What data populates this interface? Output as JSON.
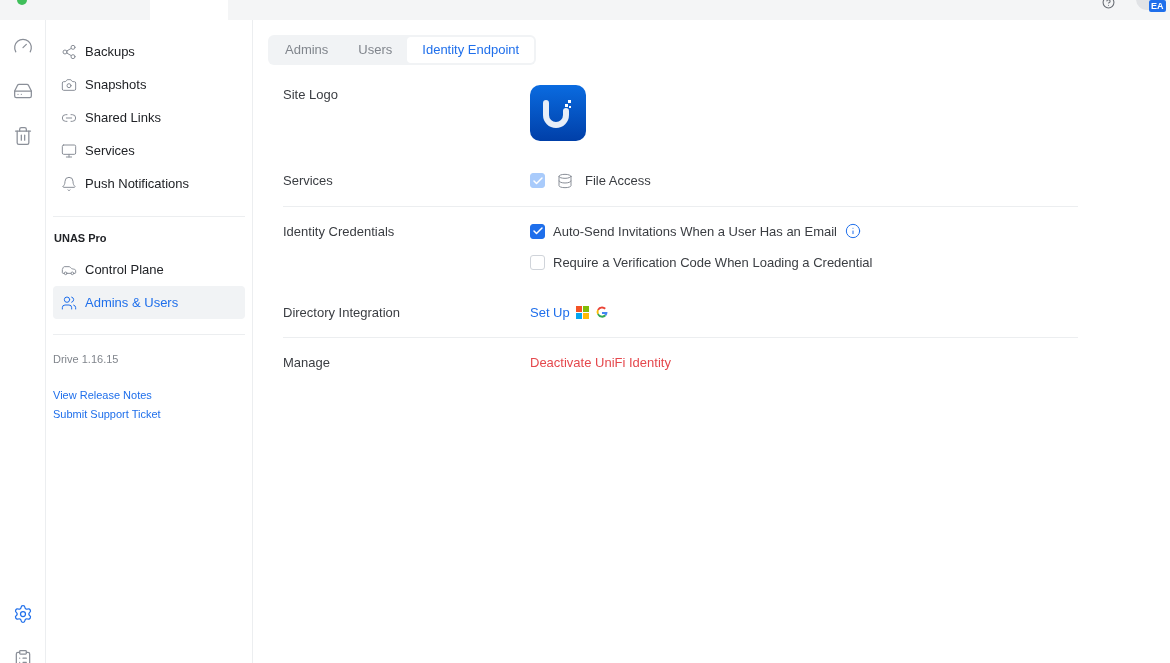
{
  "top_bar": {
    "avatar_badge": "EA"
  },
  "rail": [
    {
      "selected": false
    },
    {
      "selected": false
    },
    {
      "selected": false
    }
  ],
  "rail_bottom": [
    {
      "selected": true
    },
    {
      "selected": false
    }
  ],
  "sidebar": {
    "items": [
      {
        "label": "Backups",
        "selected": false
      },
      {
        "label": "Snapshots",
        "selected": false
      },
      {
        "label": "Shared Links",
        "selected": false
      },
      {
        "label": "Services",
        "selected": false
      },
      {
        "label": "Push Notifications",
        "selected": false
      }
    ],
    "section_title": "UNAS Pro",
    "section_items": [
      {
        "label": "Control Plane",
        "selected": false
      },
      {
        "label": "Admins & Users",
        "selected": true
      }
    ],
    "version": "Drive 1.16.15",
    "links": [
      "View Release Notes",
      "Submit Support Ticket"
    ]
  },
  "tabs": [
    {
      "label": "Admins",
      "selected": false
    },
    {
      "label": "Users",
      "selected": false
    },
    {
      "label": "Identity Endpoint",
      "selected": true
    }
  ],
  "setting_groups": [
    [
      {
        "kind": "logo",
        "label": "Site Logo"
      },
      {
        "kind": "checkboxes",
        "label": "Services",
        "options": [
          {
            "kind": "service",
            "text": "File Access",
            "checked": true,
            "disabled": true
          }
        ]
      }
    ],
    [
      {
        "kind": "checkboxes",
        "label": "Identity Credentials",
        "options": [
          {
            "kind": "info",
            "text": "Auto-Send Invitations When a User Has an Email",
            "checked": true,
            "disabled": false
          },
          {
            "kind": "plain",
            "text": "Require a Verification Code When Loading a Credential",
            "checked": false,
            "disabled": false
          }
        ]
      },
      {
        "kind": "link",
        "label": "Directory Integration",
        "text": "Set Up"
      }
    ],
    [
      {
        "kind": "danger",
        "label": "Manage",
        "text": "Deactivate UniFi Identity"
      }
    ]
  ]
}
